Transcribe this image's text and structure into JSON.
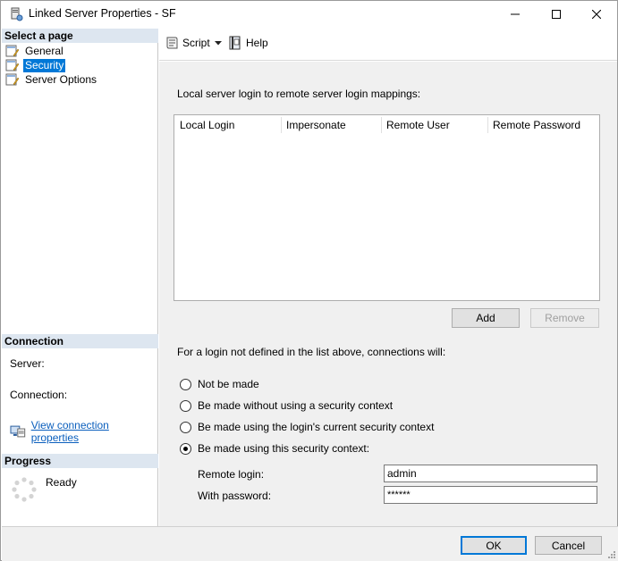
{
  "window": {
    "title": "Linked Server Properties - SF",
    "controls": {
      "minimize_icon": "minimize-icon",
      "maximize_icon": "maximize-icon",
      "close_icon": "close-icon"
    }
  },
  "left_pane": {
    "select_page_header": "Select a page",
    "pages": [
      {
        "label": "General",
        "icon": "page-wrench-icon",
        "selected": false
      },
      {
        "label": "Security",
        "icon": "page-wrench-icon",
        "selected": true
      },
      {
        "label": "Server Options",
        "icon": "page-wrench-icon",
        "selected": false
      }
    ],
    "connection_header": "Connection",
    "server_label": "Server:",
    "connection_label": "Connection:",
    "view_connection_link": "View connection properties",
    "progress_header": "Progress",
    "progress_status": "Ready"
  },
  "toolbar": {
    "script_label": "Script",
    "help_label": "Help"
  },
  "content": {
    "mappings_label": "Local server login to remote server login mappings:",
    "columns": [
      "Local Login",
      "Impersonate",
      "Remote User",
      "Remote Password"
    ],
    "add_button": "Add",
    "remove_button": "Remove",
    "not_defined_label": "For a login not defined in the list above, connections will:",
    "options": [
      {
        "label": "Not be made",
        "checked": false
      },
      {
        "label": "Be made without using a security context",
        "checked": false
      },
      {
        "label": "Be made using the login's current security context",
        "checked": false
      },
      {
        "label": "Be made using this security context:",
        "checked": true
      }
    ],
    "remote_login_label": "Remote login:",
    "remote_login_value": "admin",
    "with_password_label": "With password:",
    "password_value": "******"
  },
  "buttons": {
    "ok": "OK",
    "cancel": "Cancel"
  },
  "colors": {
    "selection": "#0078d7",
    "section_header": "#dde6f0",
    "link": "#0b5fbd",
    "panel_bg": "#f0f0f0"
  }
}
